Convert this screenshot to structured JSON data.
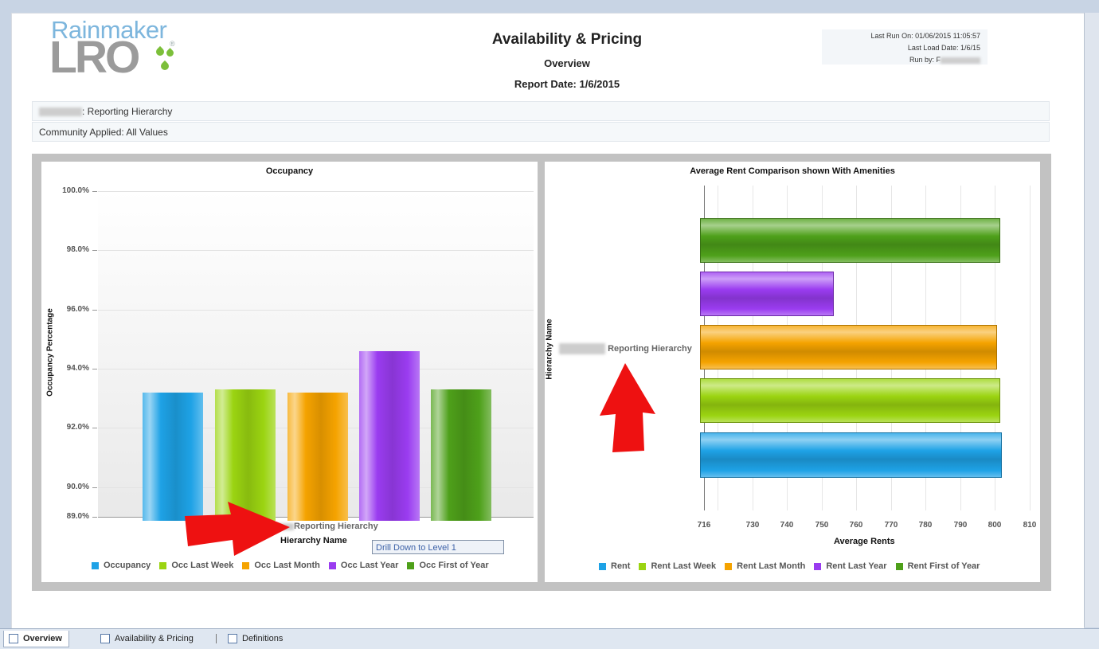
{
  "header": {
    "logo_top": "Rainmaker",
    "logo_bottom": "LRO",
    "logo_reg": "®",
    "title": "Availability & Pricing",
    "subtitle": "Overview",
    "report_date": "Report Date: 1/6/2015",
    "last_run": "Last Run On: 01/06/2015 11:05:57",
    "last_load": "Last Load Date: 1/6/15",
    "run_by": "Run by: F"
  },
  "filters": {
    "hierarchy_label": ": Reporting Hierarchy",
    "community": "Community Applied: All Values"
  },
  "occupancy_chart": {
    "title": "Occupancy",
    "ylabel": "Occupancy Percentage",
    "xlabel": "Hierarchy Name",
    "category_label": "Reporting Hierarchy",
    "yticks": [
      "100.0%",
      "98.0%",
      "96.0%",
      "94.0%",
      "92.0%",
      "90.0%",
      "89.0%"
    ],
    "legend": [
      "Occupancy",
      "Occ Last Week",
      "Occ Last Month",
      "Occ Last Year",
      "Occ First of Year"
    ]
  },
  "rent_chart": {
    "title": "Average Rent Comparison shown With Amenities",
    "ylabel": "Hierarchy Name",
    "xlabel": "Average Rents",
    "category_label": "Reporting Hierarchy",
    "xticks": [
      "716",
      "730",
      "740",
      "750",
      "760",
      "770",
      "780",
      "790",
      "800",
      "810"
    ],
    "legend": [
      "Rent",
      "Rent Last Week",
      "Rent Last Month",
      "Rent Last Year",
      "Rent First of Year"
    ]
  },
  "chart_data": [
    {
      "type": "bar",
      "title": "Occupancy",
      "xlabel": "Hierarchy Name",
      "ylabel": "Occupancy Percentage",
      "categories": [
        "Reporting Hierarchy"
      ],
      "ylim": [
        89.0,
        100.0
      ],
      "series": [
        {
          "name": "Occupancy",
          "values": [
            93.2
          ]
        },
        {
          "name": "Occ Last Week",
          "values": [
            93.3
          ]
        },
        {
          "name": "Occ Last Month",
          "values": [
            93.2
          ]
        },
        {
          "name": "Occ Last Year",
          "values": [
            94.6
          ]
        },
        {
          "name": "Occ First of Year",
          "values": [
            93.3
          ]
        }
      ],
      "grid": true,
      "legend": "bottom"
    },
    {
      "type": "bar",
      "orientation": "horizontal",
      "title": "Average Rent Comparison shown With Amenities",
      "xlabel": "Average Rents",
      "ylabel": "Hierarchy Name",
      "categories": [
        "Reporting Hierarchy"
      ],
      "xlim": [
        716,
        810
      ],
      "series": [
        {
          "name": "Rent",
          "values": [
            802
          ]
        },
        {
          "name": "Rent Last Week",
          "values": [
            801.5
          ]
        },
        {
          "name": "Rent Last Month",
          "values": [
            800.5
          ]
        },
        {
          "name": "Rent Last Year",
          "values": [
            753.5
          ]
        },
        {
          "name": "Rent First of Year",
          "values": [
            801.5
          ]
        }
      ],
      "grid": true,
      "legend": "bottom"
    }
  ],
  "colors": {
    "occupancy": "#1ea2e6",
    "last_week": "#9bd411",
    "last_month": "#f5a300",
    "last_year": "#9a3cf0",
    "first_of_year": "#4ea01a",
    "arrow": "#ee1111"
  },
  "tooltip": "Drill Down to Level 1",
  "tabs": [
    "Overview",
    "Availability & Pricing",
    "Definitions"
  ]
}
